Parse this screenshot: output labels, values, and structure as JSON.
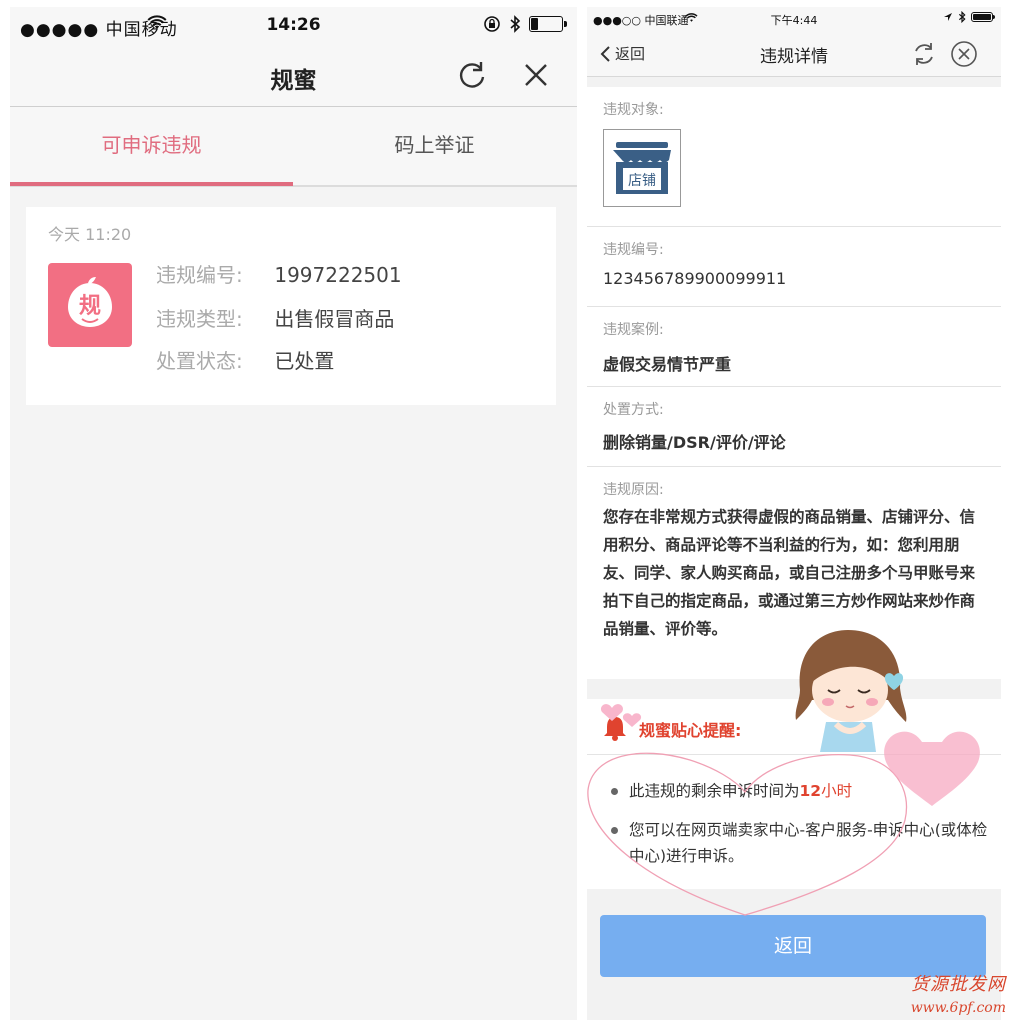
{
  "left": {
    "status": {
      "signal": "●●●●● 中国移动",
      "time": "14:26"
    },
    "nav": {
      "title": "规蜜"
    },
    "tabs": [
      {
        "label": "可申诉违规",
        "active": true
      },
      {
        "label": "码上举证",
        "active": false
      }
    ],
    "card": {
      "date": "今天 11:20",
      "avatar_char": "规",
      "rows": [
        {
          "label": "违规编号:",
          "value": "1997222501"
        },
        {
          "label": "违规类型:",
          "value": "出售假冒商品"
        },
        {
          "label": "处置状态:",
          "value": "已处置"
        }
      ]
    }
  },
  "right": {
    "status": {
      "signal": "●●●○○ 中国联通",
      "time": "下午4:44"
    },
    "nav": {
      "back": "返回",
      "title": "违规详情"
    },
    "sections": {
      "target": {
        "label": "违规对象:",
        "shop_label": "店铺"
      },
      "number": {
        "label": "违规编号:",
        "value": "123456789900099911"
      },
      "case": {
        "label": "违规案例:",
        "value": "虚假交易情节严重"
      },
      "method": {
        "label": "处置方式:",
        "value": "删除销量/DSR/评价/评论"
      },
      "reason": {
        "label": "违规原因:",
        "value": "您存在非常规方式获得虚假的商品销量、店铺评分、信用积分、商品评论等不当利益的行为，如：您利用朋友、同学、家人购买商品，或自己注册多个马甲账号来拍下自己的指定商品，或通过第三方炒作网站来炒作商品销量、评价等。"
      }
    },
    "tips": {
      "title": "规蜜贴心提醒:",
      "item1_prefix": "此违规的剩余申诉时间为",
      "item1_num": "12",
      "item1_unit": "小时",
      "item2": "您可以在网页端卖家中心-客户服务-申诉中心(或体检中心)进行申诉。"
    },
    "back_button": "返回"
  },
  "watermark": {
    "line1": "货源批发网",
    "line2": "www.6pf.com"
  },
  "colors": {
    "accent_pink": "#e06c7f",
    "avatar_pink": "#f26f83",
    "button_blue": "#76aef0",
    "warn_red": "#e0432f"
  }
}
